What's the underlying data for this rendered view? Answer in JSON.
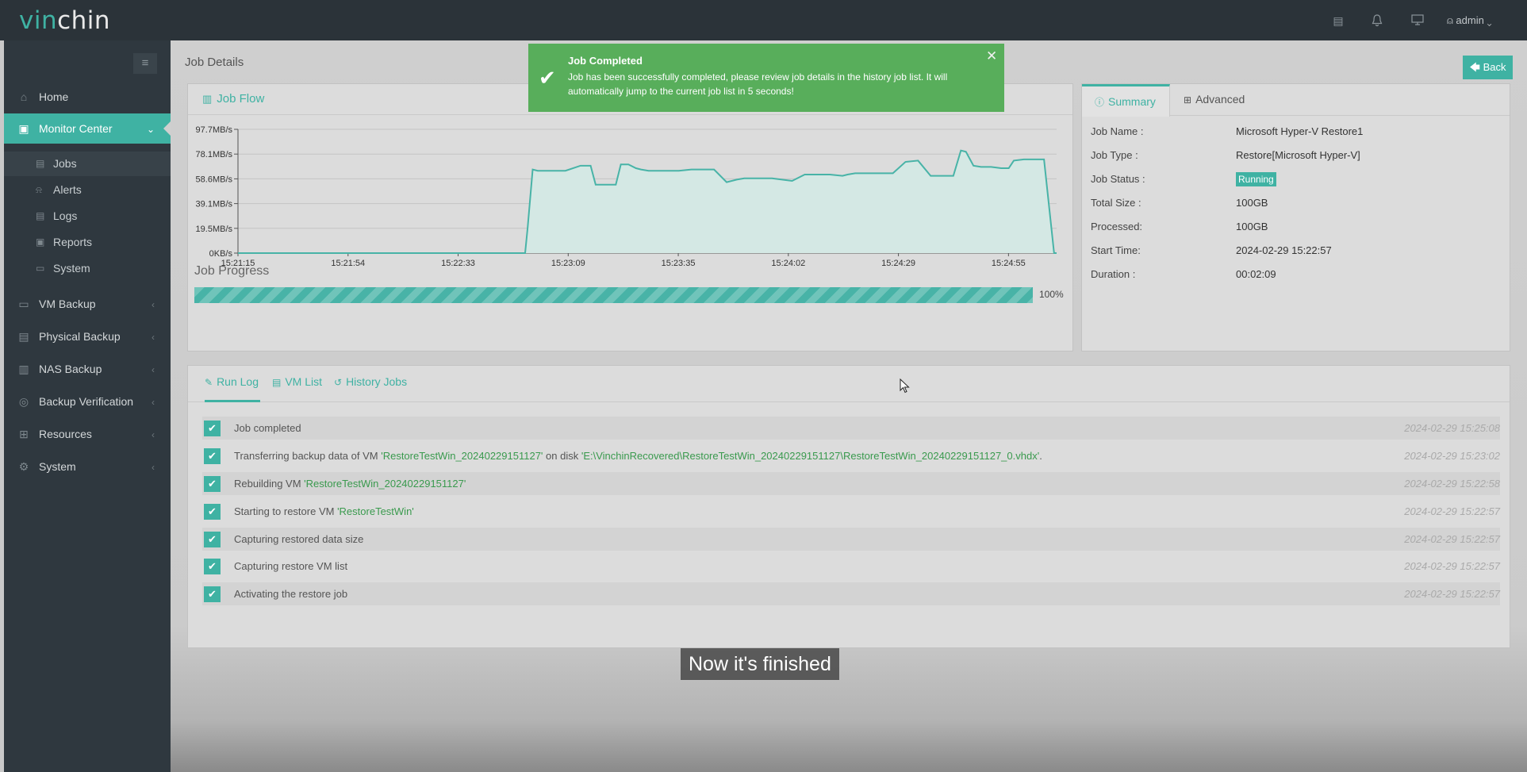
{
  "app": {
    "logo_prefix": "vin",
    "logo_suffix": "chin"
  },
  "topbar": {
    "icons": [
      "document-icon",
      "bell-icon",
      "monitor-icon",
      "user-icon"
    ],
    "user_label": "admin ⌄"
  },
  "sidebar": {
    "toggle_icon": "≡",
    "items": [
      {
        "label": "Home",
        "icon": "⌂",
        "chevron": ""
      },
      {
        "label": "Monitor Center",
        "icon": "▣",
        "chevron": "⌄"
      },
      {
        "label": "VM Backup",
        "icon": "▭",
        "chevron": "‹"
      },
      {
        "label": "Physical Backup",
        "icon": "▤",
        "chevron": "‹"
      },
      {
        "label": "NAS Backup",
        "icon": "▥",
        "chevron": "‹"
      },
      {
        "label": "Backup Verification",
        "icon": "◎",
        "chevron": "‹"
      },
      {
        "label": "Resources",
        "icon": "⊞",
        "chevron": "‹"
      },
      {
        "label": "System",
        "icon": "⚙",
        "chevron": "‹"
      }
    ],
    "subitems": [
      {
        "label": "Jobs",
        "icon": "▤"
      },
      {
        "label": "Alerts",
        "icon": "⍾"
      },
      {
        "label": "Logs",
        "icon": "▤"
      },
      {
        "label": "Reports",
        "icon": "▣"
      },
      {
        "label": "System",
        "icon": "▭"
      }
    ]
  },
  "page": {
    "title": "Job Details",
    "back_label": "Back",
    "back_icon": "🡄"
  },
  "job_flow": {
    "title": "Job Flow",
    "icon": "▥"
  },
  "chart_data": {
    "type": "area",
    "title": "",
    "xlabel": "",
    "ylabel": "",
    "y_ticks": [
      "0KB/s",
      "19.5MB/s",
      "39.1MB/s",
      "58.6MB/s",
      "78.1MB/s",
      "97.7MB/s"
    ],
    "ylim": [
      0,
      97.7
    ],
    "y_unit": "MB/s",
    "x_ticks": [
      "15:21:15",
      "15:21:54",
      "15:22:33",
      "15:23:09",
      "15:23:35",
      "15:24:02",
      "15:24:29",
      "15:24:55"
    ],
    "grid": true,
    "color": "#48b3a7",
    "fill": "#d4e8e4",
    "series": [
      {
        "x_seconds": [
          0,
          39,
          78,
          114,
          115,
          117,
          119,
          124,
          130,
          136,
          140,
          142,
          145,
          150,
          152,
          155,
          158,
          160,
          163,
          166,
          170,
          175,
          180,
          184,
          189,
          194,
          198,
          201,
          204,
          207,
          212,
          216,
          220,
          225,
          230,
          235,
          240,
          242,
          245,
          250,
          255,
          260,
          265,
          270,
          275,
          277,
          279,
          284,
          287,
          289,
          292,
          295,
          299,
          303,
          306,
          308,
          312,
          316,
          320,
          324,
          325
        ],
        "values": [
          0,
          0,
          0,
          0,
          20,
          66,
          65,
          65,
          65,
          69,
          69,
          54,
          54,
          54,
          70,
          70,
          67,
          66,
          65,
          65,
          65,
          65,
          66,
          66,
          66,
          56,
          58,
          59,
          59,
          59,
          59,
          58,
          57,
          62,
          62,
          62,
          61,
          62,
          63,
          63,
          63,
          63,
          72,
          73,
          61,
          61,
          61,
          61,
          81,
          80,
          69,
          68,
          68,
          67,
          67,
          73,
          74,
          74,
          74,
          0,
          0
        ]
      }
    ]
  },
  "progress": {
    "title": "Job Progress",
    "percent": 100,
    "label": "100%"
  },
  "summary": {
    "tabs": [
      {
        "label": "Summary",
        "icon": "ⓘ"
      },
      {
        "label": "Advanced",
        "icon": "⊞"
      }
    ],
    "fields": [
      {
        "label": "Job Name :",
        "value": "Microsoft Hyper-V Restore1"
      },
      {
        "label": "Job Type :",
        "value": "Restore[Microsoft Hyper-V]"
      },
      {
        "label": "Job Status :",
        "value": "Running"
      },
      {
        "label": "Total Size :",
        "value": "100GB"
      },
      {
        "label": "Processed:",
        "value": "100GB"
      },
      {
        "label": "Start Time:",
        "value": "2024-02-29 15:22:57"
      },
      {
        "label": "Duration :",
        "value": "00:02:09"
      }
    ]
  },
  "log": {
    "tabs": [
      {
        "label": "Run Log",
        "icon": "✎"
      },
      {
        "label": "VM List",
        "icon": "▤"
      },
      {
        "label": "History Jobs",
        "icon": "↺"
      }
    ],
    "rows": [
      {
        "pre": "Job completed",
        "hl1": "",
        "mid": "",
        "hl2": "",
        "post": "",
        "time": "2024-02-29 15:25:08"
      },
      {
        "pre": "Transferring backup data of VM ",
        "hl1": "'RestoreTestWin_20240229151127'",
        "mid": " on disk ",
        "hl2": "'E:\\VinchinRecovered\\RestoreTestWin_20240229151127\\RestoreTestWin_20240229151127_0.vhdx'",
        "post": ".",
        "time": "2024-02-29 15:23:02"
      },
      {
        "pre": "Rebuilding VM ",
        "hl1": "'RestoreTestWin_20240229151127'",
        "mid": "",
        "hl2": "",
        "post": "",
        "time": "2024-02-29 15:22:58"
      },
      {
        "pre": "Starting to restore VM ",
        "hl1": "'RestoreTestWin'",
        "mid": "",
        "hl2": "",
        "post": "",
        "time": "2024-02-29 15:22:57"
      },
      {
        "pre": "Capturing restored data size",
        "hl1": "",
        "mid": "",
        "hl2": "",
        "post": "",
        "time": "2024-02-29 15:22:57"
      },
      {
        "pre": "Capturing restore VM list",
        "hl1": "",
        "mid": "",
        "hl2": "",
        "post": "",
        "time": "2024-02-29 15:22:57"
      },
      {
        "pre": "Activating the restore job",
        "hl1": "",
        "mid": "",
        "hl2": "",
        "post": "",
        "time": "2024-02-29 15:22:57"
      }
    ]
  },
  "toast": {
    "title": "Job Completed",
    "message": "Job has been successfully completed, please review job details in the history job list. It will automatically jump to the current job list in 5 seconds!",
    "close": "✕",
    "check": "✔"
  },
  "caption": "Now it's finished"
}
